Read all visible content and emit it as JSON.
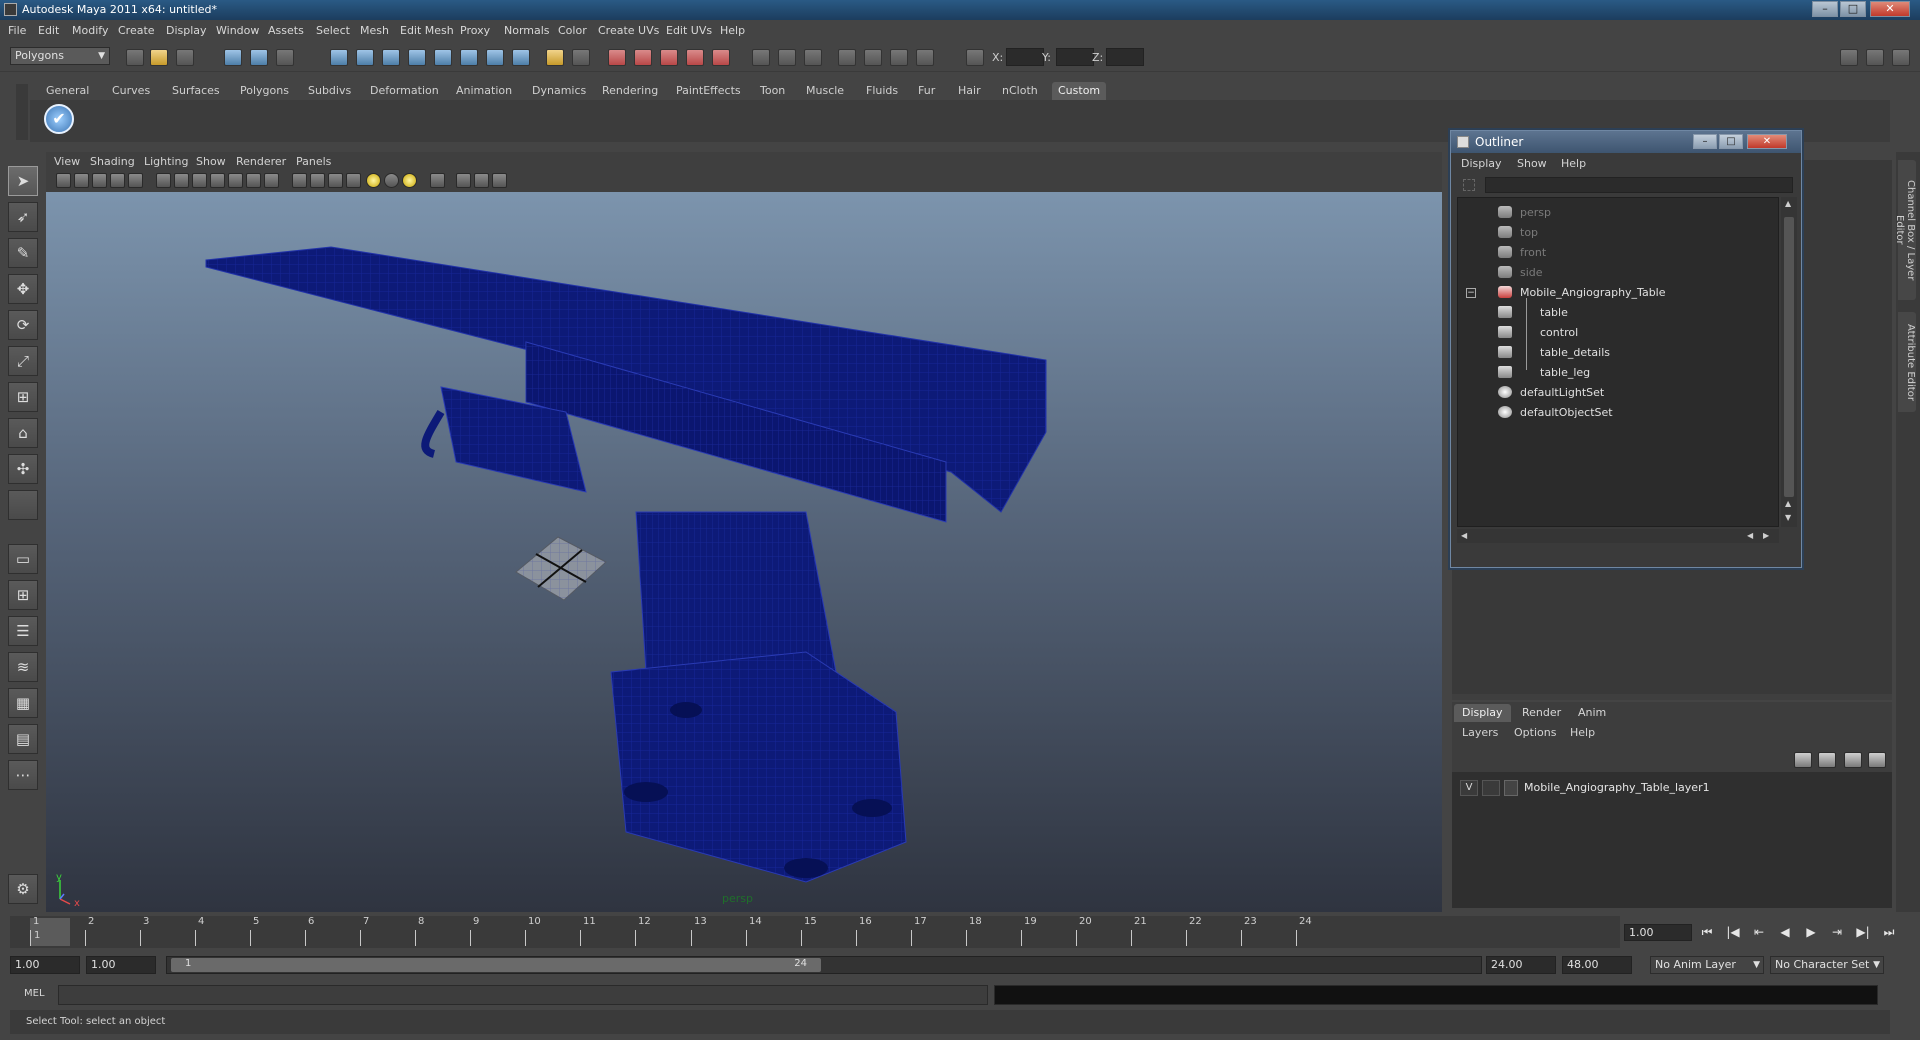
{
  "window": {
    "title": "Autodesk Maya 2011 x64: untitled*",
    "minimize": "–",
    "maximize": "□",
    "close": "✕"
  },
  "menubar": [
    "File",
    "Edit",
    "Modify",
    "Create",
    "Display",
    "Window",
    "Assets",
    "Select",
    "Mesh",
    "Edit Mesh",
    "Proxy",
    "Normals",
    "Color",
    "Create UVs",
    "Edit UVs",
    "Help"
  ],
  "status_line": {
    "mode": "Polygons",
    "x_label": "X:",
    "y_label": "Y:",
    "z_label": "Z:"
  },
  "shelf": {
    "tabs": [
      "General",
      "Curves",
      "Surfaces",
      "Polygons",
      "Subdivs",
      "Deformation",
      "Animation",
      "Dynamics",
      "Rendering",
      "PaintEffects",
      "Toon",
      "Muscle",
      "Fluids",
      "Fur",
      "Hair",
      "nCloth",
      "Custom"
    ],
    "active_tab": "Custom",
    "button_glyph": "✔"
  },
  "panel": {
    "menus": [
      "View",
      "Shading",
      "Lighting",
      "Show",
      "Renderer",
      "Panels"
    ],
    "camera": "persp",
    "axis_y": "y",
    "axis_x": "x"
  },
  "outliner": {
    "title": "Outliner",
    "menus": [
      "Display",
      "Show",
      "Help"
    ],
    "items": [
      {
        "label": "persp",
        "dim": true,
        "icon": "camera-icon"
      },
      {
        "label": "top",
        "dim": true,
        "icon": "camera-icon"
      },
      {
        "label": "front",
        "dim": true,
        "icon": "camera-icon"
      },
      {
        "label": "side",
        "dim": true,
        "icon": "camera-icon"
      },
      {
        "label": "Mobile_Angiography_Table",
        "dim": false,
        "icon": "group-icon",
        "expanded": true
      },
      {
        "label": "table",
        "dim": false,
        "icon": "mesh-icon",
        "child": true
      },
      {
        "label": "control",
        "dim": false,
        "icon": "mesh-icon",
        "child": true
      },
      {
        "label": "table_details",
        "dim": false,
        "icon": "mesh-icon",
        "child": true
      },
      {
        "label": "table_leg",
        "dim": false,
        "icon": "mesh-icon",
        "child": true
      },
      {
        "label": "defaultLightSet",
        "dim": false,
        "icon": "set-icon"
      },
      {
        "label": "defaultObjectSet",
        "dim": false,
        "icon": "set-icon"
      }
    ]
  },
  "side_tabs": [
    "Channel Box / Layer Editor",
    "Attribute Editor"
  ],
  "layer_editor": {
    "tabs": [
      "Display",
      "Render",
      "Anim"
    ],
    "active_tab": "Display",
    "menus": [
      "Layers",
      "Options",
      "Help"
    ],
    "layers": [
      {
        "visible": "V",
        "name": "Mobile_Angiography_Table_layer1"
      }
    ]
  },
  "time_slider": {
    "ticks": [
      "1",
      "2",
      "3",
      "4",
      "5",
      "6",
      "7",
      "8",
      "9",
      "10",
      "11",
      "12",
      "13",
      "14",
      "15",
      "16",
      "17",
      "18",
      "19",
      "20",
      "21",
      "22",
      "23",
      "24"
    ],
    "current_frame": "1",
    "current_time": "1.00"
  },
  "playback": [
    "⏮",
    "|◀",
    "⇤",
    "◀",
    "▶",
    "⇥",
    "▶|",
    "⏭"
  ],
  "range_slider": {
    "start_time": "1.00",
    "playback_start": "1.00",
    "range_start_label": "1",
    "range_end_label": "24",
    "playback_end": "24.00",
    "end_time": "48.00",
    "anim_layer": "No Anim Layer",
    "character_set": "No Character Set"
  },
  "command_line": {
    "language": "MEL"
  },
  "help_line": "Select Tool: select an object",
  "colors": {
    "wireframe": "#0d1a78",
    "viewport_top": "#7c94ad",
    "viewport_bottom": "#2f3440",
    "title_bar": "#2a5a85"
  }
}
